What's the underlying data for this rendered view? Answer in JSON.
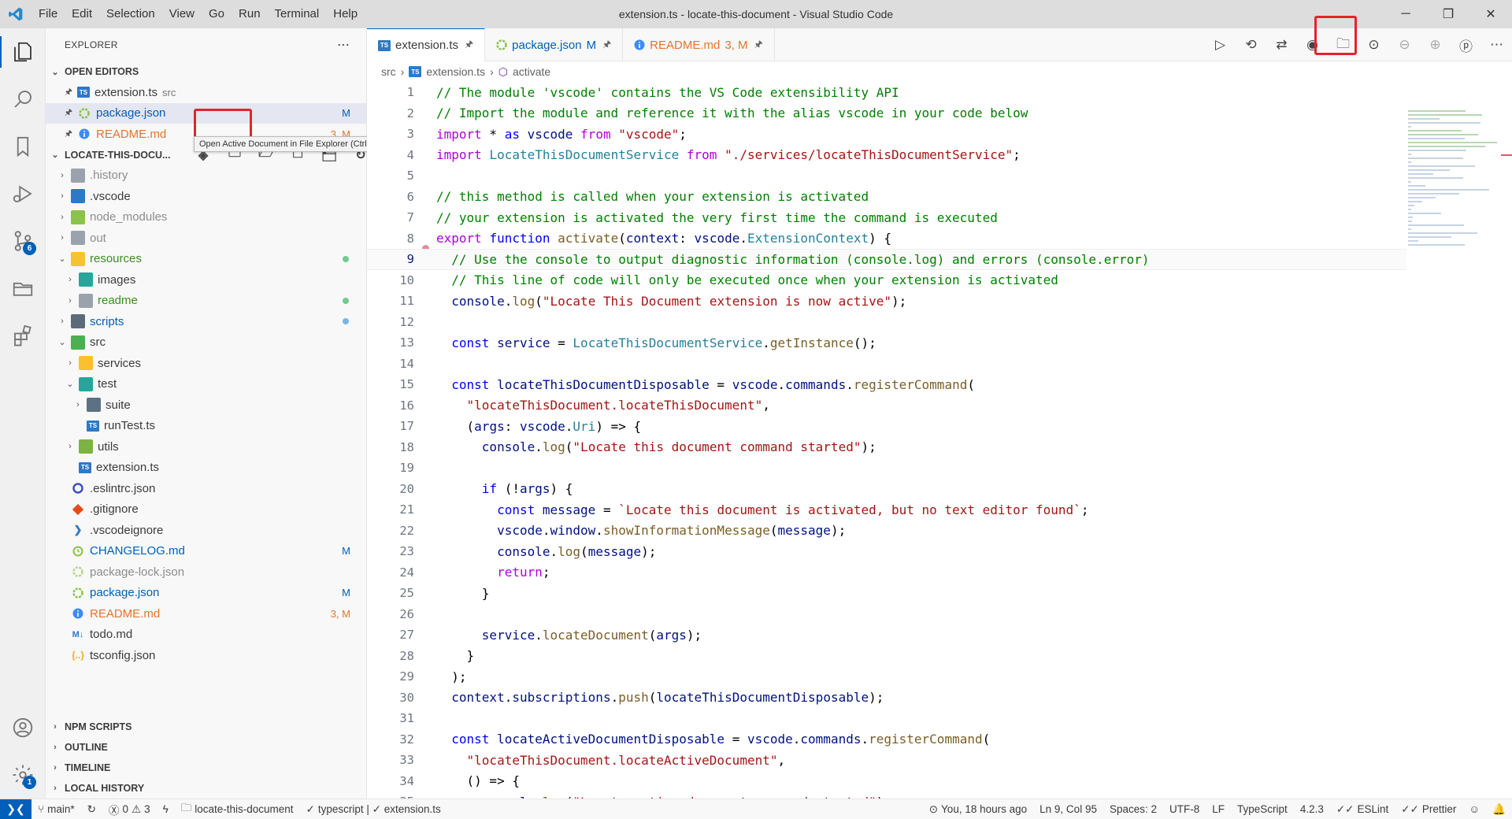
{
  "titlebar": {
    "menu": [
      "File",
      "Edit",
      "Selection",
      "View",
      "Go",
      "Run",
      "Terminal",
      "Help"
    ],
    "title": "extension.ts - locate-this-document - Visual Studio Code"
  },
  "activitybar": {
    "scm_badge": "6",
    "settings_badge": "1"
  },
  "sidebar": {
    "header": "EXPLORER",
    "open_editors": {
      "title": "OPEN EDITORS",
      "items": [
        {
          "name": "extension.ts",
          "desc": "src",
          "deco": ""
        },
        {
          "name": "package.json",
          "desc": "",
          "deco": "M"
        },
        {
          "name": "README.md",
          "desc": "",
          "deco": "3, M"
        }
      ]
    },
    "workspace": {
      "title": "LOCATE-THIS-DOCU...",
      "tooltip": "Open Active Document in File Explorer (Ctrl+Alt+')",
      "items": [
        {
          "name": ".history"
        },
        {
          "name": ".vscode"
        },
        {
          "name": "node_modules"
        },
        {
          "name": "out"
        },
        {
          "name": "resources"
        },
        {
          "name": "images"
        },
        {
          "name": "readme"
        },
        {
          "name": "scripts"
        },
        {
          "name": "src"
        },
        {
          "name": "services"
        },
        {
          "name": "test"
        },
        {
          "name": "suite"
        },
        {
          "name": "runTest.ts"
        },
        {
          "name": "utils"
        },
        {
          "name": "extension.ts"
        },
        {
          "name": ".eslintrc.json"
        },
        {
          "name": ".gitignore"
        },
        {
          "name": ".vscodeignore"
        },
        {
          "name": "CHANGELOG.md",
          "deco": "M"
        },
        {
          "name": "package-lock.json"
        },
        {
          "name": "package.json",
          "deco": "M"
        },
        {
          "name": "README.md",
          "deco": "3, M"
        },
        {
          "name": "todo.md"
        },
        {
          "name": "tsconfig.json"
        }
      ]
    },
    "bottom_sections": [
      "NPM SCRIPTS",
      "OUTLINE",
      "TIMELINE",
      "LOCAL HISTORY"
    ]
  },
  "editor": {
    "tabs": [
      {
        "label": "extension.ts",
        "suffix": ""
      },
      {
        "label": "package.json",
        "suffix": "M"
      },
      {
        "label": "README.md",
        "suffix": "3, M"
      }
    ],
    "breadcrumb": [
      "src",
      "extension.ts",
      "activate"
    ],
    "lines": [
      "// The module 'vscode' contains the VS Code extensibility API",
      "// Import the module and reference it with the alias vscode in your code below",
      "import * as vscode from \"vscode\";",
      "import LocateThisDocumentService from \"./services/locateThisDocumentService\";",
      "",
      "// this method is called when your extension is activated",
      "// your extension is activated the very first time the command is executed",
      "export function activate(context: vscode.ExtensionContext) {",
      "  // Use the console to output diagnostic information (console.log) and errors (console.error)",
      "  // This line of code will only be executed once when your extension is activated",
      "  console.log(\"Locate This Document extension is now active\");",
      "",
      "  const service = LocateThisDocumentService.getInstance();",
      "",
      "  const locateThisDocumentDisposable = vscode.commands.registerCommand(",
      "    \"locateThisDocument.locateThisDocument\",",
      "    (args: vscode.Uri) => {",
      "      console.log(\"Locate this document command started\");",
      "",
      "      if (!args) {",
      "        const message = `Locate this document is activated, but no text editor found`;",
      "        vscode.window.showInformationMessage(message);",
      "        console.log(message);",
      "        return;",
      "      }",
      "",
      "      service.locateDocument(args);",
      "    }",
      "  );",
      "  context.subscriptions.push(locateThisDocumentDisposable);",
      "",
      "  const locateActiveDocumentDisposable = vscode.commands.registerCommand(",
      "    \"locateThisDocument.locateActiveDocument\",",
      "    () => {",
      "      console.log(\"Locate active document command started\");"
    ]
  },
  "statusbar": {
    "branch": "main*",
    "errors": "0",
    "warnings": "3",
    "workspace": "locate-this-document",
    "lang_check": "typescript | ✓ extension.ts",
    "blame": "You, 18 hours ago",
    "position": "Ln 9, Col 95",
    "spaces": "Spaces: 2",
    "encoding": "UTF-8",
    "eol": "LF",
    "language": "TypeScript",
    "version": "4.2.3",
    "eslint": "ESLint",
    "prettier": "Prettier"
  }
}
